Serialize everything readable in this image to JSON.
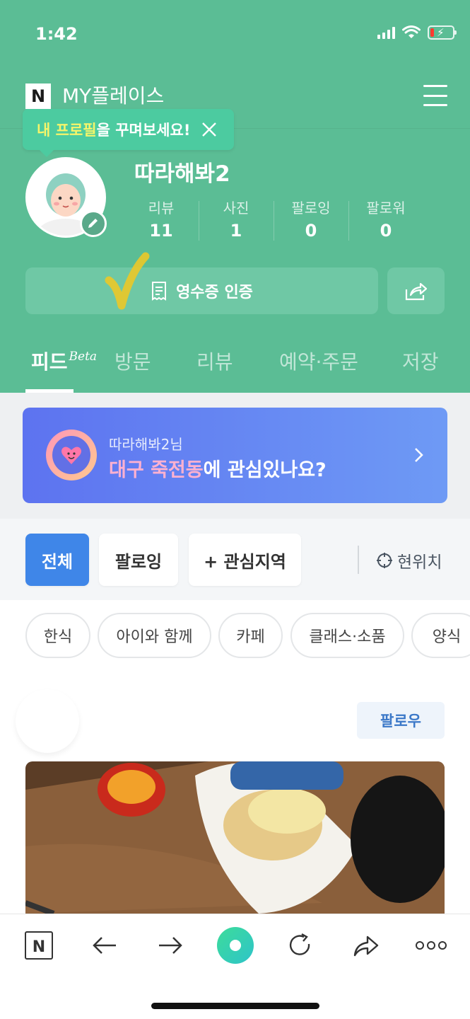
{
  "status": {
    "time": "1:42"
  },
  "header": {
    "logo": "N",
    "title": "MY플레이스"
  },
  "tooltip": {
    "highlight": "내 프로필",
    "rest": "을 꾸며보세요!"
  },
  "profile": {
    "name": "따라해봐2",
    "stats": [
      {
        "label": "리뷰",
        "value": "11"
      },
      {
        "label": "사진",
        "value": "1"
      },
      {
        "label": "팔로잉",
        "value": "0"
      },
      {
        "label": "팔로워",
        "value": "0"
      }
    ]
  },
  "receipt_button": {
    "label": "영수증 인증"
  },
  "tabs": {
    "feed": "피드",
    "beta": "Beta",
    "visit": "방문",
    "review": "리뷰",
    "reserve": "예약·주문",
    "saved": "저장"
  },
  "banner": {
    "subtitle": "따라해봐2님",
    "highlight": "대구 죽전동",
    "rest": "에 관심있나요?"
  },
  "filters": {
    "all": "전체",
    "following": "팔로잉",
    "interest": "+ 관심지역",
    "location": "현위치"
  },
  "categories": [
    "한식",
    "아이와 함께",
    "카페",
    "클래스·소품",
    "양식"
  ],
  "feed": {
    "follow_label": "팔로우"
  },
  "colors": {
    "brand": "#5bbd95",
    "accent": "#3f86e8",
    "banner": "#5d73f0"
  },
  "icons": {
    "menu": "hamburger-icon",
    "close": "close-icon",
    "edit": "pencil-icon",
    "receipt": "receipt-icon",
    "share": "share-icon",
    "chevron": "chevron-right-icon",
    "location": "crosshair-icon",
    "back": "arrow-left-icon",
    "forward": "arrow-right-icon",
    "reload": "reload-icon",
    "more": "more-icon"
  }
}
